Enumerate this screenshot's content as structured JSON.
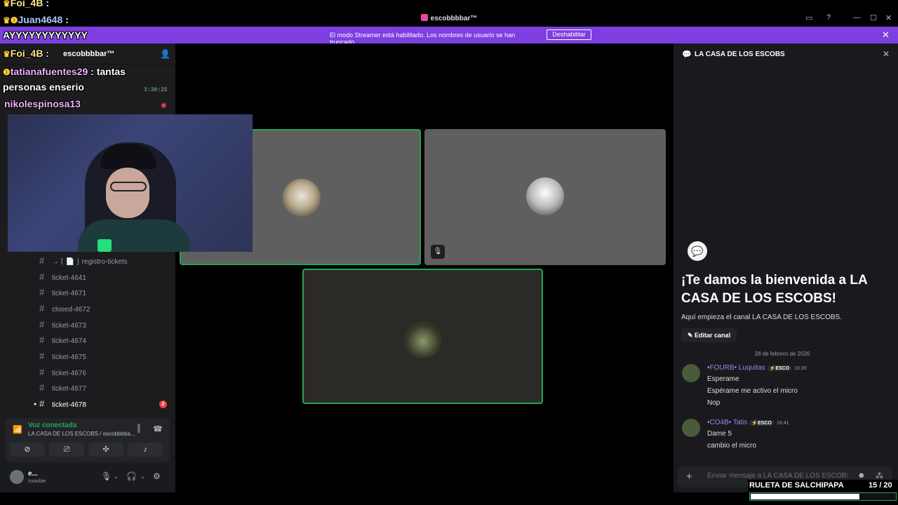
{
  "window": {
    "title": "escobbbbar™",
    "controls": [
      "▭",
      "?",
      "—",
      "☐",
      "✕"
    ]
  },
  "banner": {
    "message": "El modo Streamer está habilitado. Los nombres de usuario se han truncado.",
    "button": "Deshabilitar",
    "close": "✕"
  },
  "overlay_chat": [
    {
      "badges": "♛",
      "user": "Foi_4B",
      "sep": " : ",
      "text": ""
    },
    {
      "badges": "♛❶",
      "user": "Juan4648",
      "sep": " : ",
      "text": ""
    },
    {
      "badges": "",
      "user": "",
      "sep": "",
      "text": "AYYYYYYYYYYYY"
    },
    {
      "badges": "♛",
      "user": "Foi_4B",
      "sep": " : ",
      "text": ""
    },
    {
      "badges": "❶",
      "user": "tatianafuentes29",
      "sep": " : ",
      "text": "tantas"
    },
    {
      "badges": "",
      "user": "",
      "sep": "",
      "text": "personas enserio"
    },
    {
      "badges": "",
      "user": "nikolespinosa13",
      "sep": "",
      "text": ""
    }
  ],
  "server": {
    "name": "escobbbbar™",
    "timer": "3:30:25"
  },
  "channels": [
    {
      "prefix": "→ ⌈ 📄 ⌋",
      "name": "registro-tickets",
      "badge": ""
    },
    {
      "prefix": "",
      "name": "ticket-4641",
      "badge": ""
    },
    {
      "prefix": "",
      "name": "ticket-4671",
      "badge": ""
    },
    {
      "prefix": "",
      "name": "closed-4672",
      "badge": ""
    },
    {
      "prefix": "",
      "name": "ticket-4673",
      "badge": ""
    },
    {
      "prefix": "",
      "name": "ticket-4674",
      "badge": ""
    },
    {
      "prefix": "",
      "name": "ticket-4675",
      "badge": ""
    },
    {
      "prefix": "",
      "name": "ticket-4676",
      "badge": ""
    },
    {
      "prefix": "",
      "name": "ticket-4677",
      "badge": ""
    },
    {
      "prefix": "",
      "name": "ticket-4678",
      "badge": "2"
    }
  ],
  "voice": {
    "status": "Voz conectada",
    "location": "LA CASA DE LOS ESCOBS / escobbbba...",
    "buttons": [
      "camera-off",
      "screen-share",
      "activities",
      "soundboard"
    ]
  },
  "user": {
    "name": "e...",
    "status": "Invisible"
  },
  "chat": {
    "channel": "LA CASA DE LOS ESCOBS",
    "welcome_title": "¡Te damos la bienvenida a LA CASA DE LOS ESCOBS!",
    "welcome_sub": "Aquí empieza el canal LA CASA DE LOS ESCOBS.",
    "edit_button": "Editar canal",
    "date_divider": "28 de febrero de 2026",
    "messages": [
      {
        "author": "•FOURB• Luquitas",
        "tag": "ESCO",
        "time": "16:39",
        "lines": [
          "Esperame",
          "Espérame me activo el micro",
          "Nop"
        ]
      },
      {
        "author": "•CO4B• Tatis",
        "tag": "ESCO",
        "time": "16:41",
        "lines": [
          "Dame 5",
          "cambio el micro"
        ]
      }
    ],
    "composer_placeholder": "Enviar mensaje a LA CASA DE LOS ESCOBS"
  },
  "ruleta": {
    "label": "RULETA DE SALCHIPAPA",
    "current": "15",
    "total": "/ 20",
    "progress": 0.75
  },
  "colors": {
    "accent": "#7d3fe0",
    "speaking": "#23a55a",
    "name_purple": "#a97fe6",
    "mention_red": "#f23f43"
  }
}
